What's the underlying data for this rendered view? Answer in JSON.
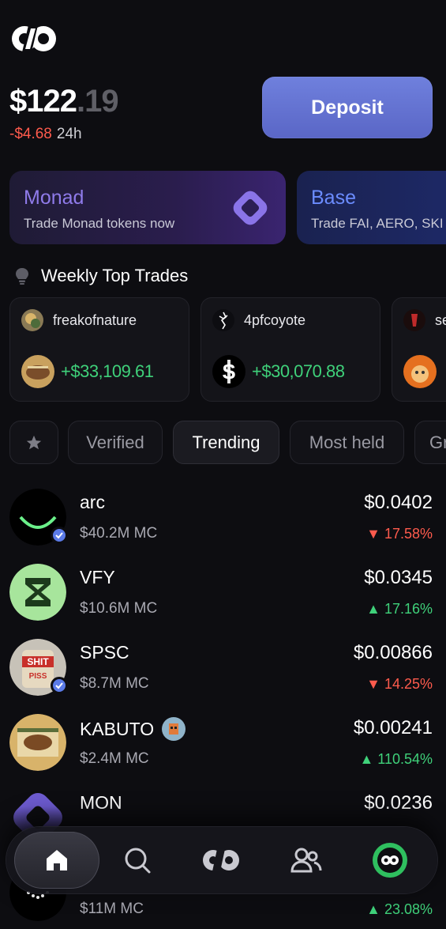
{
  "portfolio": {
    "balance_main": "$122",
    "balance_cents": ".19",
    "change": "-$4.68",
    "change_period": "24h",
    "deposit_label": "Deposit"
  },
  "promos": [
    {
      "title": "Monad",
      "subtitle": "Trade Monad tokens now"
    },
    {
      "title": "Base",
      "subtitle": "Trade FAI, AERO, SKI a"
    }
  ],
  "weekly": {
    "title": "Weekly Top Trades",
    "cards": [
      {
        "user": "freakofnature",
        "gain": "+$33,109.61"
      },
      {
        "user": "4pfcoyote",
        "gain": "+$30,070.88"
      },
      {
        "user": "se",
        "gain": ""
      }
    ]
  },
  "filters": {
    "tabs": [
      "Verified",
      "Trending",
      "Most held",
      "Gr"
    ],
    "active": "Trending"
  },
  "tokens": [
    {
      "name": "arc",
      "mc": "$40.2M MC",
      "price": "$0.0402",
      "change": "▼ 17.58%",
      "dir": "down"
    },
    {
      "name": "VFY",
      "mc": "$10.6M MC",
      "price": "$0.0345",
      "change": "▲ 17.16%",
      "dir": "up"
    },
    {
      "name": "SPSC",
      "mc": "$8.7M MC",
      "price": "$0.00866",
      "change": "▼ 14.25%",
      "dir": "down"
    },
    {
      "name": "KABUTO",
      "mc": "$2.4M MC",
      "price": "$0.00241",
      "change": "▲ 110.54%",
      "dir": "up"
    },
    {
      "name": "MON",
      "mc": "",
      "price": "$0.0236",
      "change": "",
      "dir": "down"
    },
    {
      "name": "",
      "mc": "$11M MC",
      "price": "",
      "change": "▲ 23.08%",
      "dir": "up"
    }
  ],
  "colors": {
    "accent": "#6f80dd",
    "up": "#3fd17a",
    "down": "#ff5b4d",
    "background": "#0d0d11"
  },
  "nav": [
    "home-icon",
    "search-icon",
    "logo-icon",
    "people-icon",
    "profile-icon"
  ]
}
